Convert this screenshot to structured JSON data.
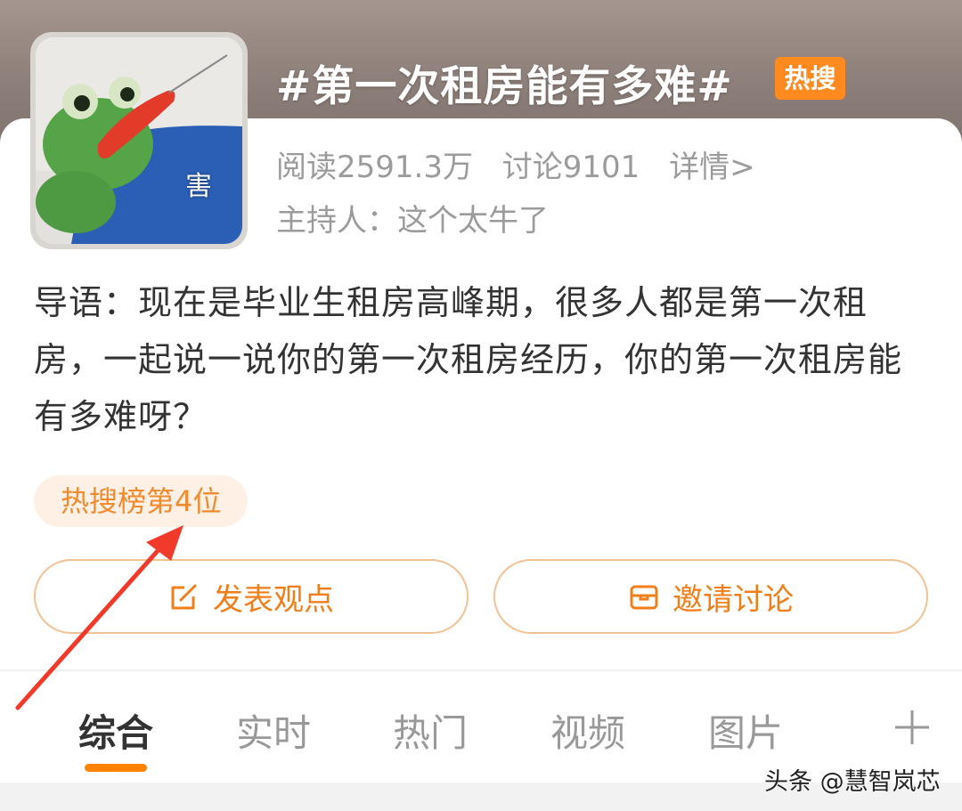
{
  "topic": {
    "title": "#第一次租房能有多难#",
    "badge": "热搜",
    "stats": {
      "reads": "阅读2591.3万",
      "discussions": "讨论9101",
      "details_link": "详情>"
    },
    "host": "主持人：这个太牛了",
    "avatar_mark": "害",
    "intro": "导语：现在是毕业生租房高峰期，很多人都是第一次租房，一起说一说你的第一次租房经历，你的第一次租房能有多难呀？",
    "rank_tag": "热搜榜第4位"
  },
  "actions": {
    "post_label": "发表观点",
    "invite_label": "邀请讨论"
  },
  "tabs": [
    {
      "label": "综合",
      "active": true
    },
    {
      "label": "实时",
      "active": false
    },
    {
      "label": "热门",
      "active": false
    },
    {
      "label": "视频",
      "active": false
    },
    {
      "label": "图片",
      "active": false
    }
  ],
  "watermark": "头条 @慧智岚芯",
  "colors": {
    "accent": "#ff8200",
    "badge": "#ff8a1f",
    "annotation_arrow": "#f23a2a"
  }
}
